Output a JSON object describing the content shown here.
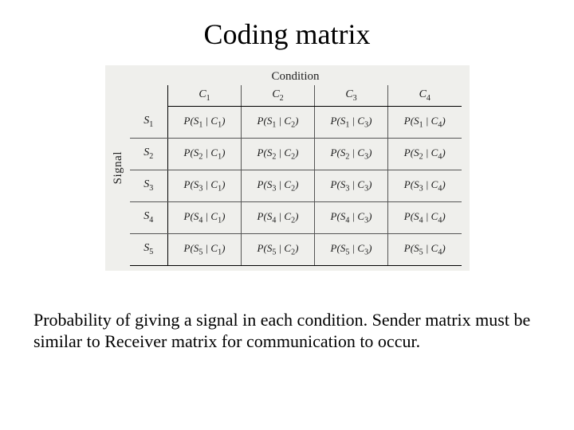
{
  "title": "Coding matrix",
  "figure": {
    "top_label": "Condition",
    "side_label": "Signal",
    "col_headers": [
      "C1",
      "C2",
      "C3",
      "C4"
    ],
    "row_headers": [
      "S1",
      "S2",
      "S3",
      "S4",
      "S5"
    ],
    "cells": [
      [
        "P(S1 | C1)",
        "P(S1 | C2)",
        "P(S1 | C3)",
        "P(S1 | C4)"
      ],
      [
        "P(S2 | C1)",
        "P(S2 | C2)",
        "P(S2 | C3)",
        "P(S2 | C4)"
      ],
      [
        "P(S3 | C1)",
        "P(S3 | C2)",
        "P(S3 | C3)",
        "P(S3 | C4)"
      ],
      [
        "P(S4 | C1)",
        "P(S4 | C2)",
        "P(S4 | C3)",
        "P(S4 | C4)"
      ],
      [
        "P(S5 | C1)",
        "P(S5 | C2)",
        "P(S5 | C3)",
        "P(S5 | C4)"
      ]
    ]
  },
  "caption": "Probability of giving a signal in each condition.  Sender matrix must be similar to Receiver matrix for communication to occur.",
  "chart_data": {
    "type": "table",
    "title": "Coding matrix",
    "row_axis": "Signal",
    "col_axis": "Condition",
    "columns": [
      "C1",
      "C2",
      "C3",
      "C4"
    ],
    "rows": [
      "S1",
      "S2",
      "S3",
      "S4",
      "S5"
    ],
    "values": [
      [
        "P(S1|C1)",
        "P(S1|C2)",
        "P(S1|C3)",
        "P(S1|C4)"
      ],
      [
        "P(S2|C1)",
        "P(S2|C2)",
        "P(S2|C3)",
        "P(S2|C4)"
      ],
      [
        "P(S3|C1)",
        "P(S3|C2)",
        "P(S3|C3)",
        "P(S3|C4)"
      ],
      [
        "P(S4|C1)",
        "P(S4|C2)",
        "P(S4|C3)",
        "P(S4|C4)"
      ],
      [
        "P(S5|C1)",
        "P(S5|C2)",
        "P(S5|C3)",
        "P(S5|C4)"
      ]
    ]
  }
}
